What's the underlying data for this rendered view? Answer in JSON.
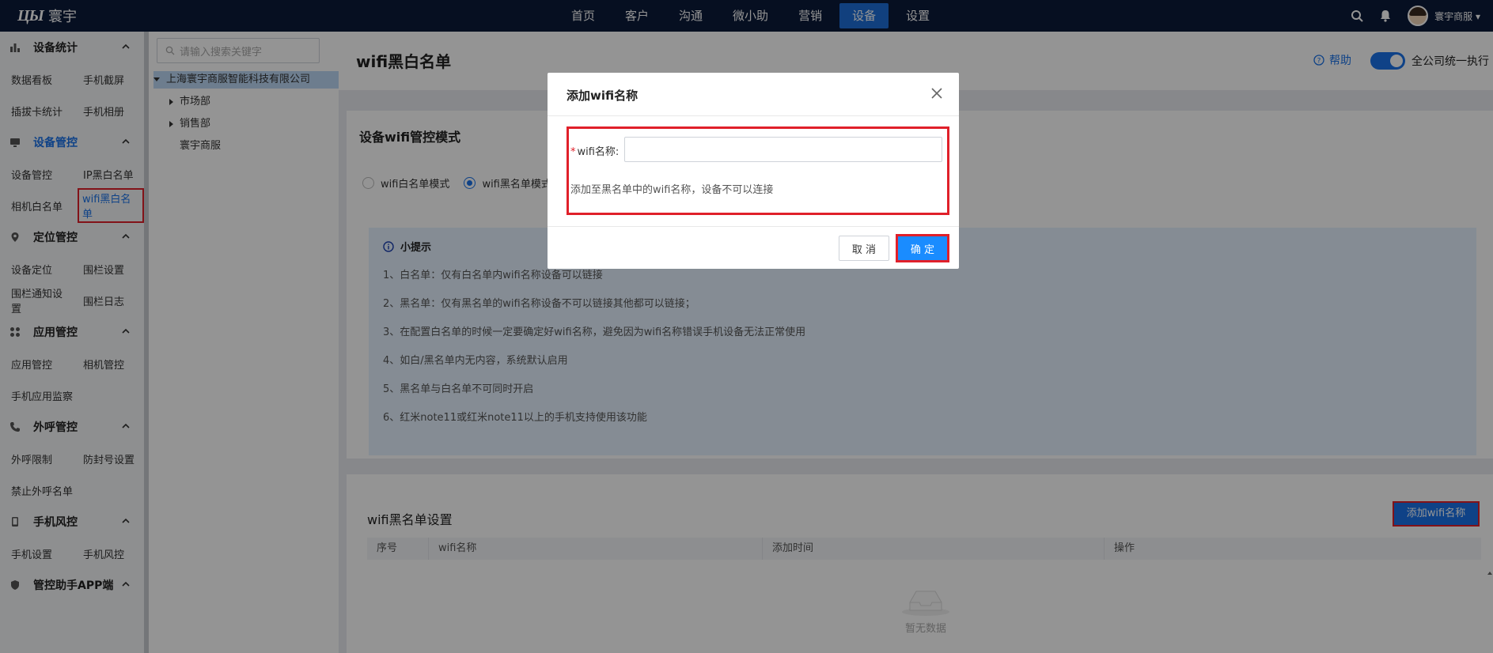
{
  "app": {
    "logo_mark": "ЦЫ",
    "brand_name": "寰宇"
  },
  "nav": {
    "items": [
      {
        "label": "首页"
      },
      {
        "label": "客户"
      },
      {
        "label": "沟通"
      },
      {
        "label": "微小助"
      },
      {
        "label": "营销"
      },
      {
        "label": "设备",
        "active": true
      },
      {
        "label": "设置"
      }
    ],
    "user_name": "寰宇商服 ▾",
    "icons": [
      "search-icon",
      "bell-icon",
      "avatar"
    ]
  },
  "sidebar": {
    "groups": [
      {
        "title": "设备统计",
        "icon": "bar-chart-icon",
        "items": [
          "数据看板",
          "手机截屏",
          "插拔卡统计",
          "手机相册"
        ]
      },
      {
        "title": "设备管控",
        "icon": "monitor-icon",
        "active": true,
        "items": [
          "设备管控",
          "IP黑白名单",
          "相机白名单",
          "wifi黑白名单"
        ],
        "selected": "wifi黑白名单"
      },
      {
        "title": "定位管控",
        "icon": "location-icon",
        "items": [
          "设备定位",
          "围栏设置",
          "围栏通知设置",
          "围栏日志"
        ]
      },
      {
        "title": "应用管控",
        "icon": "apps-icon",
        "items": [
          "应用管控",
          "相机管控",
          "手机应用监察"
        ]
      },
      {
        "title": "外呼管控",
        "icon": "phone-icon",
        "items": [
          "外呼限制",
          "防封号设置",
          "禁止外呼名单"
        ]
      },
      {
        "title": "手机风控",
        "icon": "mobile-icon",
        "items": [
          "手机设置",
          "手机风控"
        ]
      },
      {
        "title": "管控助手APP端",
        "icon": "shield-icon",
        "items": []
      }
    ]
  },
  "tree": {
    "search_placeholder": "请输入搜索关键字",
    "root": "上海寰宇商服智能科技有限公司",
    "children": [
      "市场部",
      "销售部",
      "寰宇商服"
    ]
  },
  "page": {
    "title": "wifi黑白名单",
    "help_label": "帮助",
    "switch_label": "全公司统一执行",
    "switch_on": true
  },
  "mode_card": {
    "title": "设备wifi管控模式",
    "options": [
      {
        "label": "wifi白名单模式",
        "checked": false
      },
      {
        "label": "wifi黑名单模式",
        "checked": true
      }
    ],
    "tips_title": "小提示",
    "tips": [
      "1、白名单：仅有白名单内wifi名称设备可以链接",
      "2、黑名单：仅有黑名单的wifi名称设备不可以链接其他都可以链接；",
      "3、在配置白名单的时候一定要确定好wifi名称，避免因为wifi名称错误手机设备无法正常使用",
      "4、如白/黑名单内无内容，系统默认启用",
      "5、黑名单与白名单不可同时开启",
      "6、红米note11或红米note11以上的手机支持使用该功能"
    ]
  },
  "list_card": {
    "title": "wifi黑名单设置",
    "add_button": "添加wifi名称",
    "columns": [
      "序号",
      "wifi名称",
      "添加时间",
      "操作"
    ],
    "empty_text": "暂无数据"
  },
  "modal": {
    "title": "添加wifi名称",
    "field_label": "wifi名称:",
    "required_mark": "*",
    "field_value": "",
    "hint": "添加至黑名单中的wifi名称，设备不可以连接",
    "cancel_label": "取 消",
    "ok_label": "确 定"
  },
  "colors": {
    "topbar": "#0c1a3a",
    "accent": "#1a73e8",
    "highlight_box": "#e0202a",
    "tips_bg": "#e6f2ff"
  }
}
